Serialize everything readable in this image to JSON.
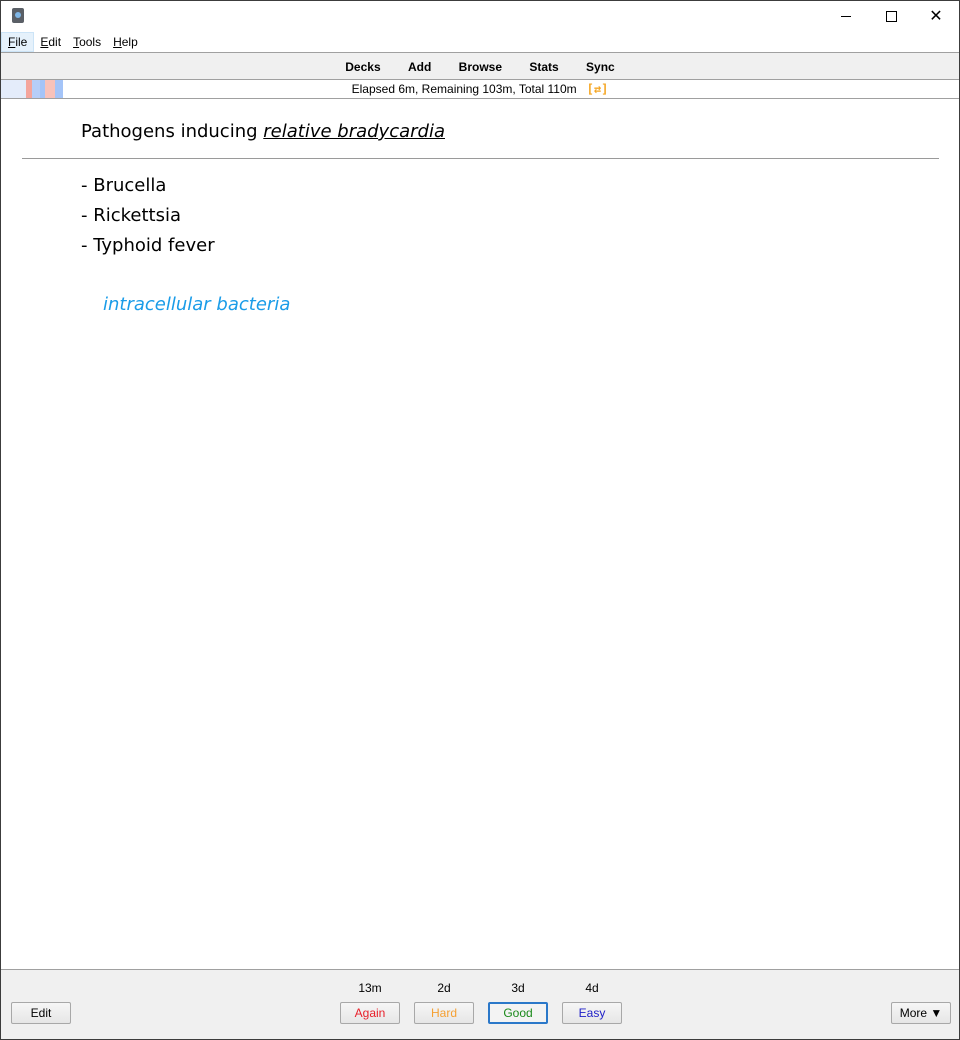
{
  "window": {
    "app_icon": "anki-icon",
    "controls": {
      "minimize": "minimize-icon",
      "maximize": "maximize-icon",
      "close": "close-icon"
    }
  },
  "menu": {
    "items": [
      {
        "label_underlined": "F",
        "label_rest": "ile",
        "active": true
      },
      {
        "label_underlined": "E",
        "label_rest": "dit",
        "active": false
      },
      {
        "label_underlined": "T",
        "label_rest": "ools",
        "active": false
      },
      {
        "label_underlined": "H",
        "label_rest": "elp",
        "active": false
      }
    ]
  },
  "toolbar": {
    "links": [
      "Decks",
      "Add",
      "Browse",
      "Stats",
      "Sync"
    ]
  },
  "progress": {
    "text": "Elapsed 6m, Remaining 103m, Total 110m",
    "icon": "swap-icon",
    "icon_glyph": "[⇄]",
    "icon_color": "#f5a623",
    "segment_colors": [
      "#e4ecfa",
      "#f4a59c",
      "#b6cef8",
      "#a4c4f8",
      "#f8c2ba",
      "#a4c4f8"
    ]
  },
  "card": {
    "question_prefix": "Pathogens inducing ",
    "question_term": "relative bradycardia",
    "answers": [
      "- Brucella",
      "- Rickettsia",
      "- Typhoid fever"
    ],
    "extra": "intracellular bacteria",
    "extra_color": "#1a9ce8"
  },
  "bottom": {
    "edit_label": "Edit",
    "more_label": "More ▼",
    "ease_buttons": [
      {
        "time": "13m",
        "label": "Again",
        "color": "#e8202a"
      },
      {
        "time": "2d",
        "label": "Hard",
        "color": "#f5a033"
      },
      {
        "time": "3d",
        "label": "Good",
        "color": "#1b8a1b",
        "focused": true
      },
      {
        "time": "4d",
        "label": "Easy",
        "color": "#2020c8"
      }
    ]
  }
}
